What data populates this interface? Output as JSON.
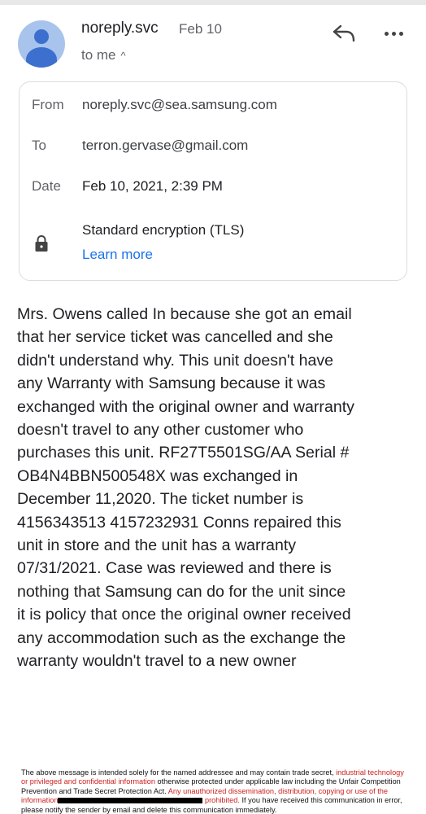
{
  "header": {
    "sender": "noreply.svc",
    "date_short": "Feb 10",
    "to_me": "to me"
  },
  "details": {
    "from_label": "From",
    "from_value": "noreply.svc@sea.samsung.com",
    "to_label": "To",
    "to_value": "terron.gervase@gmail.com",
    "date_label": "Date",
    "date_value": "Feb 10, 2021, 2:39 PM",
    "encryption": "Standard encryption (TLS)",
    "learn_more": "Learn more"
  },
  "message": {
    "body": "Mrs. Owens called In because she got an email\nthat her service ticket was cancelled and she\ndidn't understand why. This unit doesn't have\nany Warranty with Samsung because it was\nexchanged with the original owner and warranty\ndoesn't travel to any other customer who\npurchases this unit. RF27T5501SG/AA Serial #\nOB4N4BBN500548X was exchanged in\nDecember 11,2020. The ticket number is\n4156343513 4157232931 Conns repaired this\nunit in store and the unit has a warranty\n07/31/2021. Case was reviewed and there is\nnothing that Samsung can do for the unit since\nit is policy that once the original owner received\nany accommodation such as the exchange the\nwarranty wouldn't travel to a new owner"
  },
  "footer": {
    "part1": "The above message is intended solely for the named addressee and may contain trade secret, ",
    "part2": "industrial technology or privileged and confidential information",
    "part3": " otherwise protected under applicable law including the Unfair Competition Prevention and Trade Secret Protection Act. ",
    "part4": "Any unauthorized dissemination, distribution, copying or use of the information",
    "part5": " prohibited.",
    "part6": " If you have received this communication in error, please notify the sender by email and delete this communication immediately."
  },
  "colors": {
    "link": "#1a73e8",
    "avatar_bg": "#a8c4ec",
    "avatar_fg": "#3d6fcf",
    "footer_red": "#cc1f1f"
  },
  "icons": [
    "avatar-person-icon",
    "reply-icon",
    "more-options-icon",
    "chevron-up-icon",
    "lock-icon"
  ]
}
